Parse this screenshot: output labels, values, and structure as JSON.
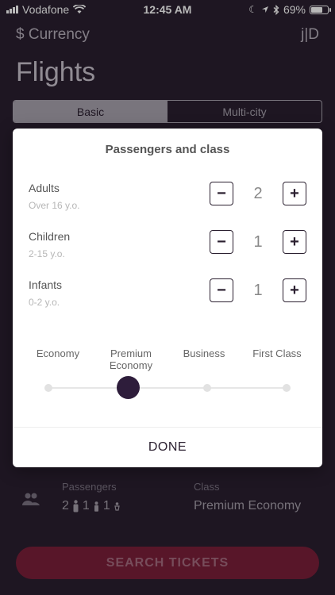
{
  "status_bar": {
    "carrier": "Vodafone",
    "time": "12:45 AM",
    "battery": "69%"
  },
  "header": {
    "currency_label": "$ Currency",
    "logo_text": "j|D",
    "title": "Flights"
  },
  "tabs": [
    {
      "label": "Basic",
      "active": true
    },
    {
      "label": "Multi-city",
      "active": false
    }
  ],
  "modal": {
    "title": "Passengers and class",
    "passengers": [
      {
        "label": "Adults",
        "sub": "Over 16 y.o.",
        "value": "2"
      },
      {
        "label": "Children",
        "sub": "2-15 y.o.",
        "value": "1"
      },
      {
        "label": "Infants",
        "sub": "0-2 y.o.",
        "value": "1"
      }
    ],
    "minus_symbol": "−",
    "plus_symbol": "+",
    "classes": [
      "Economy",
      "Premium Economy",
      "Business",
      "First Class"
    ],
    "selected_class_index": 1,
    "done_label": "DONE"
  },
  "summary": {
    "passengers_label": "Passengers",
    "adults": "2",
    "children": "1",
    "infants": "1",
    "class_label": "Class",
    "class_value": "Premium Economy"
  },
  "search_button": "SEARCH TICKETS",
  "colors": {
    "background": "#2a1f30",
    "accent": "#7a1f3a",
    "knob": "#2e1d3b"
  }
}
